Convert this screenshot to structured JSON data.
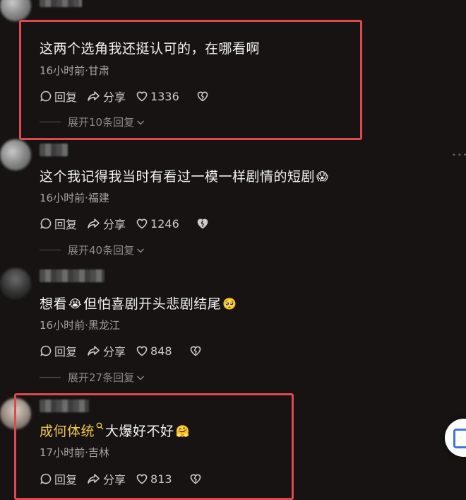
{
  "comments": [
    {
      "text": "这两个选角我还挺认可的，在哪看啊",
      "meta": "16小时前·甘肃",
      "reply_label": "回复",
      "share_label": "分享",
      "likes": "1336",
      "expand": "展开10条回复"
    },
    {
      "text": "这个我记得我当时有看过一模一样剧情的短剧",
      "emoji": "😱",
      "meta": "16小时前·福建",
      "reply_label": "回复",
      "share_label": "分享",
      "likes": "1246",
      "expand": "展开40条回复"
    },
    {
      "text_a": "想看",
      "emoji_a": "😭",
      "text_b": "但怕喜剧开头悲剧结尾",
      "emoji_b": "🥺",
      "meta": "16小时前·黑龙江",
      "reply_label": "回复",
      "share_label": "分享",
      "likes": "848",
      "expand": "展开27条回复"
    },
    {
      "author_tag": "成何体统",
      "text": "大爆好不好",
      "emoji": "🤗",
      "meta": "17小时前·吉林",
      "reply_label": "回复",
      "share_label": "分享",
      "likes": "813"
    }
  ],
  "colors": {
    "background": "#171313",
    "highlight": "#e0474f",
    "author_tag": "#f2c74b"
  },
  "icons": [
    "comment-icon",
    "share-icon",
    "heart-icon",
    "broken-heart-icon",
    "chevron-down-icon",
    "search-icon"
  ]
}
